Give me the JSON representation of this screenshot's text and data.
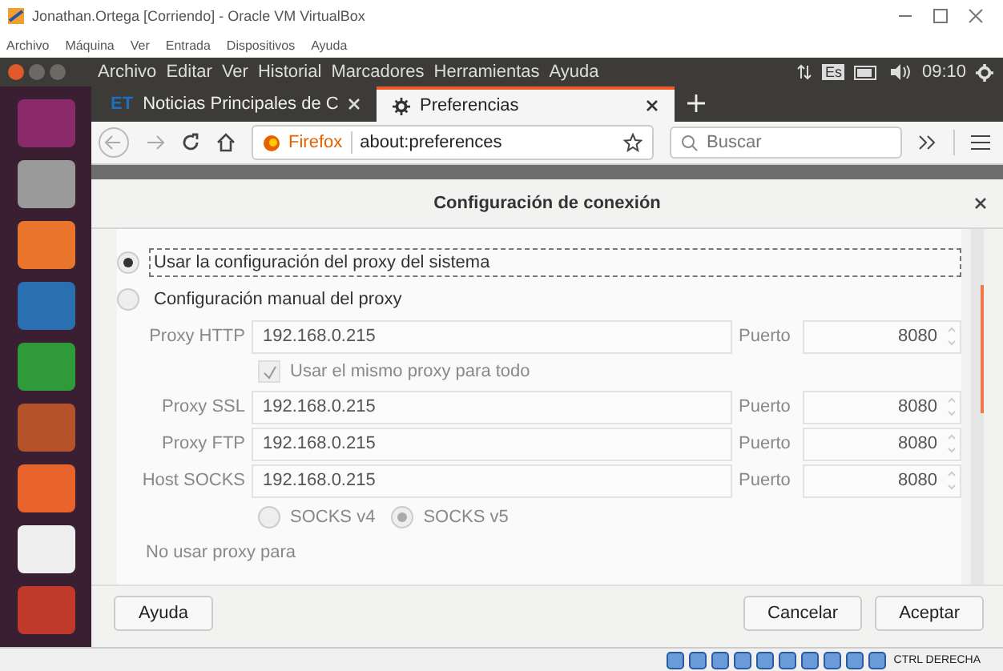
{
  "window": {
    "title": "Jonathan.Ortega [Corriendo] - Oracle VM VirtualBox"
  },
  "vbox_menu": [
    "Archivo",
    "Máquina",
    "Ver",
    "Entrada",
    "Dispositivos",
    "Ayuda"
  ],
  "ubuntu_menu": [
    "Archivo",
    "Editar",
    "Ver",
    "Historial",
    "Marcadores",
    "Herramientas",
    "Ayuda"
  ],
  "tray": {
    "language": "Es",
    "time": "09:10"
  },
  "tabs": [
    {
      "label": "Noticias Principales de C",
      "badge": "ET",
      "selected": false
    },
    {
      "label": "Preferencias",
      "selected": true
    }
  ],
  "address": {
    "brand": "Firefox",
    "url": "about:preferences"
  },
  "search": {
    "placeholder": "Buscar"
  },
  "dialog": {
    "title": "Configuración de conexión",
    "options": [
      {
        "kind": "radio",
        "label": "Usar la configuración del proxy del sistema",
        "selected": true,
        "focused": true
      },
      {
        "kind": "radio",
        "label": "Configuración manual del proxy",
        "selected": false,
        "focused": false
      }
    ],
    "proxies": [
      {
        "label": "Proxy HTTP",
        "host": "192.168.0.215",
        "port_label": "Puerto",
        "port": "8080"
      },
      {
        "kind": "checkbox",
        "label": "Usar el mismo proxy para todo",
        "checked": true
      },
      {
        "label": "Proxy SSL",
        "host": "192.168.0.215",
        "port_label": "Puerto",
        "port": "8080"
      },
      {
        "label": "Proxy FTP",
        "host": "192.168.0.215",
        "port_label": "Puerto",
        "port": "8080"
      },
      {
        "label": "Host SOCKS",
        "host": "192.168.0.215",
        "port_label": "Puerto",
        "port": "8080"
      }
    ],
    "socks": [
      {
        "label": "SOCKS v4",
        "selected": false
      },
      {
        "label": "SOCKS v5",
        "selected": true
      }
    ],
    "no_proxy_label": "No usar proxy para",
    "buttons": {
      "help": "Ayuda",
      "cancel": "Cancelar",
      "accept": "Aceptar"
    }
  },
  "status_bar": {
    "host_key": "CTRL DERECHA"
  }
}
